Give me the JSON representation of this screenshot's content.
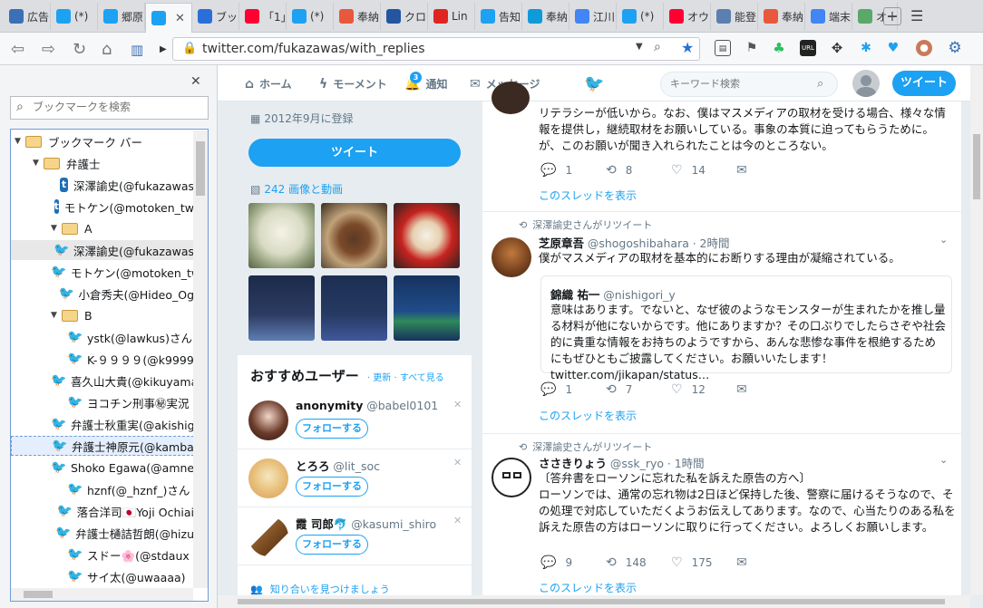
{
  "browser": {
    "tabs": [
      {
        "label": "広告",
        "icon": "globe-icon",
        "color": "#3b6fb6"
      },
      {
        "label": "(*)",
        "icon": "twitter-icon",
        "color": "#1da1f2"
      },
      {
        "label": "郷原",
        "icon": "twitter-icon",
        "color": "#1da1f2"
      },
      {
        "label": "",
        "icon": "twitter-icon",
        "color": "#1da1f2",
        "active": true
      },
      {
        "label": "ブッ",
        "icon": "star-icon",
        "color": "#2a6fd8"
      },
      {
        "label": "「1」",
        "icon": "yahoo-icon",
        "color": "#ff0033"
      },
      {
        "label": "(*)",
        "icon": "twitter-icon",
        "color": "#1da1f2"
      },
      {
        "label": "奉納",
        "icon": "hatena-icon",
        "color": "#e8583d"
      },
      {
        "label": "クロ",
        "icon": "news-icon",
        "color": "#2355a0"
      },
      {
        "label": "Lin",
        "icon": "red-square-icon",
        "color": "#e0241f"
      },
      {
        "label": "告知",
        "icon": "twitter-icon",
        "color": "#1da1f2"
      },
      {
        "label": "奉納",
        "icon": "t-icon",
        "color": "#0f9ad9"
      },
      {
        "label": "江川",
        "icon": "google-icon",
        "color": "#4285f4"
      },
      {
        "label": "(*)",
        "icon": "twitter-icon",
        "color": "#1da1f2"
      },
      {
        "label": "オウ",
        "icon": "yahoo-icon",
        "color": "#ff0033"
      },
      {
        "label": "能登",
        "icon": "cube-icon",
        "color": "#5a7fb0"
      },
      {
        "label": "奉納",
        "icon": "hatena-icon",
        "color": "#e8583d"
      },
      {
        "label": "端末",
        "icon": "google-icon",
        "color": "#4285f4"
      },
      {
        "label": "オー",
        "icon": "leaf-icon",
        "color": "#5aa86a"
      }
    ],
    "tab_close": "✕",
    "url": "twitter.com/fukazawas/with_replies"
  },
  "bookmarks": {
    "close": "✕",
    "search_placeholder": "ブックマークを検索",
    "tree": [
      {
        "label": "ブックマーク バー",
        "type": "folder",
        "level": 0
      },
      {
        "label": "弁護士",
        "type": "folder",
        "level": 1
      },
      {
        "label": "深澤諭史(@fukazawas",
        "type": "tblog",
        "level": 2
      },
      {
        "label": "モトケン(@motoken_tw",
        "type": "tblog",
        "level": 2
      },
      {
        "label": "A",
        "type": "folder",
        "level": 2
      },
      {
        "label": "深澤諭史(@fukazawas",
        "type": "twitter",
        "level": 3,
        "selected": true
      },
      {
        "label": "モトケン(@motoken_tw",
        "type": "twitter",
        "level": 3
      },
      {
        "label": "小倉秀夫(@Hideo_Og",
        "type": "twitter",
        "level": 3
      },
      {
        "label": "B",
        "type": "folder",
        "level": 2
      },
      {
        "label": "ystk(@lawkus)さん",
        "type": "twitter",
        "level": 3
      },
      {
        "label": "K-９９９９(@k9999",
        "type": "twitter",
        "level": 3
      },
      {
        "label": "喜久山大貴(@kikuyama",
        "type": "twitter",
        "level": 3
      },
      {
        "label": "ヨコチン刑事㊙実況",
        "type": "twitter",
        "level": 3
      },
      {
        "label": "弁護士秋重実(@akishige",
        "type": "twitter",
        "level": 3
      },
      {
        "label": "弁護士神原元(@kambara",
        "type": "twitter",
        "level": 3,
        "highlight": true
      },
      {
        "label": "Shoko Egawa(@amneris",
        "type": "twitter",
        "level": 3
      },
      {
        "label": "hznf(@_hznf_)さん",
        "type": "twitter",
        "level": 3
      },
      {
        "label": "落合洋司🇯🇵Yoji Ochiai",
        "type": "twitter",
        "level": 3
      },
      {
        "label": "弁護士樋詰哲朗(@hizu",
        "type": "twitter",
        "level": 3
      },
      {
        "label": "スドー🌸(@stdaux",
        "type": "twitter",
        "level": 3
      },
      {
        "label": "サイ太(@uwaaaa)",
        "type": "twitter",
        "level": 3
      }
    ]
  },
  "twitter": {
    "nav": {
      "home": "ホーム",
      "moments": "モーメント",
      "notifications": "通知",
      "notif_count": "3",
      "messages": "メッセージ",
      "search_placeholder": "キーワード検索",
      "tweet_button": "ツイート"
    },
    "profile": {
      "joined": "2012年9月に登録",
      "tweet_button": "ツイート",
      "media_label": "242 画像と動画"
    },
    "suggestions": {
      "title": "おすすめユーザー",
      "refresh": "更新",
      "view_all": "すべて見る",
      "users": [
        {
          "name": "anonymity",
          "handle": "@babel0101",
          "follow": "フォローする"
        },
        {
          "name": "とろろ",
          "handle": "@lit_soc",
          "follow": "フォローする"
        },
        {
          "name": "霞 司郎🐬",
          "handle": "@kasumi_shiro",
          "follow": "フォローする"
        }
      ],
      "find_friends": "知り合いを見つけましょう"
    },
    "timeline": [
      {
        "text": "リテラシーが低いから。なお、僕はマスメディアの取材を受ける場合、様々な情報を提供し，継続取材をお願いしている。事象の本質に迫ってもらうために。が、このお願いが聞き入れられたことは今のところない。",
        "replies": "1",
        "retweets": "8",
        "likes": "14",
        "show_thread": "このスレッドを表示"
      },
      {
        "retweet_label": "深澤諭史さんがリツイート",
        "name": "芝原章吾",
        "handle": "@shogoshibahara",
        "time": "2時間",
        "text": "僕がマスメディアの取材を基本的にお断りする理由が凝縮されている。",
        "quote": {
          "name": "錦織 祐一",
          "handle": "@nishigori_y",
          "text": "意味はあります。でないと、なぜ彼のようなモンスターが生まれたかを推し量る材料が他にないからです。他にありますか？その口ぶりでしたらさぞや社会的に貴重な情報をお持ちのようですから、あんな悲惨な事件を根絶するためにもぜひともご披露してください。お願いいたします！twitter.com/jikapan/status…"
        },
        "replies": "1",
        "retweets": "7",
        "likes": "12",
        "show_thread": "このスレッドを表示"
      },
      {
        "retweet_label": "深澤諭史さんがリツイート",
        "name": "ささきりょう",
        "handle": "@ssk_ryo",
        "time": "1時間",
        "text": "〔答弁書をローソンに忘れた私を訴えた原告の方へ〕\nローソンでは、通常の忘れ物は2日ほど保持した後、警察に届けるそうなので、その処理で対応していただくようお伝えしてあります。なので、心当たりのある私を訴えた原告の方はローソンに取りに行ってください。よろしくお願いします。",
        "replies": "9",
        "retweets": "148",
        "likes": "175",
        "show_thread": "このスレッドを表示"
      }
    ],
    "accent": "#1da1f2"
  }
}
